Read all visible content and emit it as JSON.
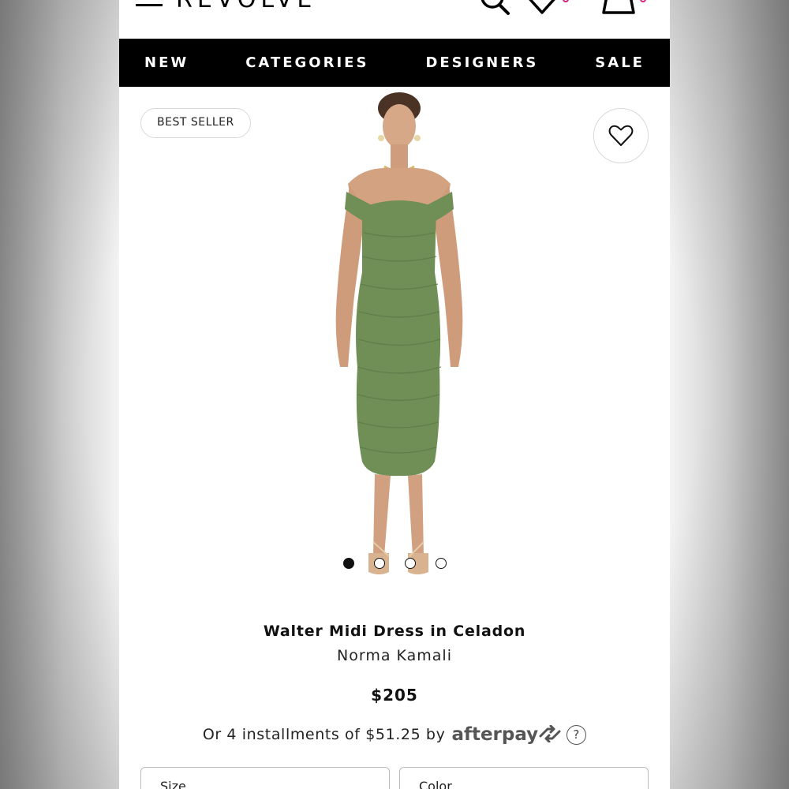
{
  "header": {
    "logo": "REVOLVE",
    "menu_icon": "hamburger-icon",
    "search_icon": "search-icon",
    "wishlist_icon": "heart-icon",
    "bag_icon": "bag-icon",
    "badge_color": "#d4247a"
  },
  "nav": {
    "items": [
      {
        "label": "NEW"
      },
      {
        "label": "CATEGORIES"
      },
      {
        "label": "DESIGNERS"
      },
      {
        "label": "SALE"
      }
    ]
  },
  "product": {
    "badge": "BEST SELLER",
    "wishlist_icon": "heart-outline-icon",
    "image_count": 4,
    "active_image": 1,
    "dress_color": "#6f8f57",
    "name": "Walter Midi Dress in Celadon",
    "designer": "Norma Kamali",
    "price": "$205",
    "installments_text": "Or 4 installments of $51.25 by",
    "afterpay_label": "afterpay",
    "help_label": "?"
  },
  "options": {
    "size_label": "Size",
    "color_label": "Color"
  }
}
